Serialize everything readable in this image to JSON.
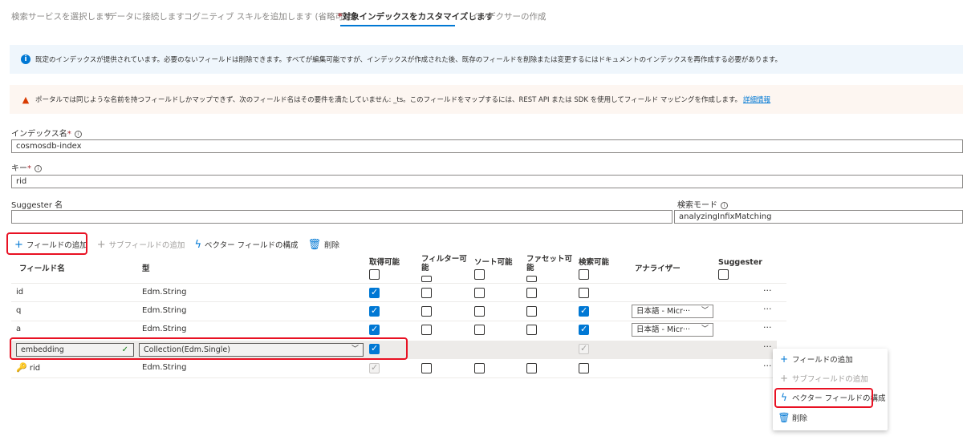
{
  "tabs": [
    {
      "label": "検索サービスを選択します",
      "active": false
    },
    {
      "label": "データに接続します",
      "required": true,
      "active": false
    },
    {
      "label": "コグニティブ スキルを追加します (省略可能)",
      "active": false
    },
    {
      "label": "対象インデックスをカスタマイズします",
      "required": true,
      "active": true
    },
    {
      "label": "インデクサーの作成",
      "active": false
    }
  ],
  "required_mark": "*",
  "info_banner": {
    "icon": "info-icon",
    "text": "既定のインデックスが提供されています。必要のないフィールドは削除できます。すべてが編集可能ですが、インデックスが作成された後、既存のフィールドを削除または変更するにはドキュメントのインデックスを再作成する必要があります。"
  },
  "warning_banner": {
    "icon": "warning-icon",
    "text": "ポータルでは同じような名前を持つフィールドしかマップできず、次のフィールド名はその要件を満たしていません: _ts。このフィールドをマップするには、REST API または SDK を使用してフィールド マッピングを作成します。",
    "link": "詳細情報"
  },
  "form": {
    "index_name_label": "インデックス名",
    "index_name_value": "cosmosdb-index",
    "key_label": "キー",
    "key_value": "rid",
    "suggester_label": "Suggester 名",
    "suggester_value": "",
    "search_mode_label": "検索モード",
    "search_mode_value": "analyzingInfixMatching"
  },
  "toolbar": {
    "add_field": "フィールドの追加",
    "add_subfield": "サブフィールドの追加",
    "vector_config": "ベクター フィールドの構成",
    "delete": "削除"
  },
  "table": {
    "headers": {
      "field_name": "フィールド名",
      "type": "型",
      "retrievable": "取得可能",
      "filterable_1": "フィルター可",
      "filterable_2": "能",
      "sortable": "ソート可能",
      "facetable_1": "ファセット可",
      "facetable_2": "能",
      "searchable": "検索可能",
      "analyzer": "アナライザー",
      "suggester": "Suggester"
    },
    "rows": [
      {
        "name": "id",
        "type": "Edm.String",
        "retrievable": true,
        "filterable": false,
        "sortable": false,
        "facetable": false,
        "searchable": false,
        "analyzer": ""
      },
      {
        "name": "q",
        "type": "Edm.String",
        "retrievable": true,
        "filterable": false,
        "sortable": false,
        "facetable": false,
        "searchable": true,
        "analyzer": "日本語 - Micr···"
      },
      {
        "name": "a",
        "type": "Edm.String",
        "retrievable": true,
        "filterable": false,
        "sortable": false,
        "facetable": false,
        "searchable": true,
        "analyzer": "日本語 - Micr···"
      },
      {
        "name": "embedding",
        "type": "Collection(Edm.Single)",
        "retrievable": true,
        "searchable": true,
        "editing": true
      },
      {
        "name": "rid",
        "type": "Edm.String",
        "retrievable": true,
        "filterable": false,
        "sortable": false,
        "facetable": false,
        "searchable": false,
        "is_key": true
      }
    ],
    "more_label": "···"
  },
  "context_menu": {
    "items": [
      {
        "label": "フィールドの追加",
        "icon": "plus-icon",
        "disabled": false
      },
      {
        "label": "サブフィールドの追加",
        "icon": "plus-icon",
        "disabled": true
      },
      {
        "label": "ベクター フィールドの構成",
        "icon": "lightning-icon",
        "disabled": false
      },
      {
        "label": "削除",
        "icon": "trash-icon",
        "disabled": false
      }
    ]
  },
  "colors": {
    "accent": "#0078d4",
    "highlight_box": "#e81123",
    "required": "#a4262c"
  }
}
